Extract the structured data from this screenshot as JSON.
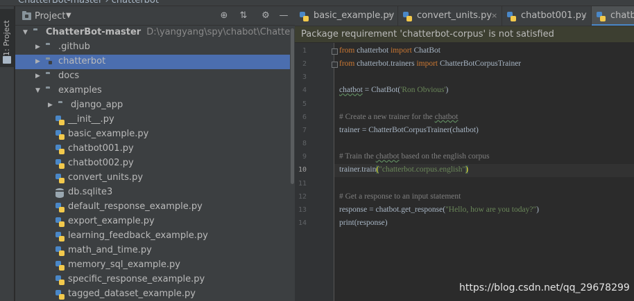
{
  "window": {
    "title_fragment": "ChatterBot-master  ›  chatterbot"
  },
  "tool_window": {
    "project_label": "1: Project"
  },
  "project_panel": {
    "title": "Project",
    "dropdown_icon": "caret-down-icon",
    "header_icons": [
      "crosshair-icon",
      "collapse-icon",
      "gear-icon",
      "minimize-icon"
    ],
    "tree": [
      {
        "label": "ChatterBot-master",
        "path": "D:\\yangyang\\spy\\chabot\\ChatterBot-master",
        "type": "folder",
        "depth": 0,
        "arrow": "down",
        "bold": true
      },
      {
        "label": ".github",
        "type": "folder",
        "depth": 1,
        "arrow": "right"
      },
      {
        "label": "chatterbot",
        "type": "folder",
        "depth": 1,
        "arrow": "right",
        "selected": true
      },
      {
        "label": "docs",
        "type": "folder",
        "depth": 1,
        "arrow": "right"
      },
      {
        "label": "examples",
        "type": "folder",
        "depth": 1,
        "arrow": "down"
      },
      {
        "label": "django_app",
        "type": "folder",
        "depth": 2,
        "arrow": "right"
      },
      {
        "label": "__init__.py",
        "type": "py",
        "depth": 2
      },
      {
        "label": "basic_example.py",
        "type": "py",
        "depth": 2
      },
      {
        "label": "chatbot001.py",
        "type": "py",
        "depth": 2
      },
      {
        "label": "chatbot002.py",
        "type": "py",
        "depth": 2
      },
      {
        "label": "convert_units.py",
        "type": "py",
        "depth": 2
      },
      {
        "label": "db.sqlite3",
        "type": "db",
        "depth": 2
      },
      {
        "label": "default_response_example.py",
        "type": "py",
        "depth": 2
      },
      {
        "label": "export_example.py",
        "type": "py",
        "depth": 2
      },
      {
        "label": "learning_feedback_example.py",
        "type": "py",
        "depth": 2
      },
      {
        "label": "math_and_time.py",
        "type": "py",
        "depth": 2
      },
      {
        "label": "memory_sql_example.py",
        "type": "py",
        "depth": 2
      },
      {
        "label": "specific_response_example.py",
        "type": "py",
        "depth": 2
      },
      {
        "label": "tagged_dataset_example.py",
        "type": "py",
        "depth": 2
      }
    ]
  },
  "editor": {
    "tabs": [
      {
        "label": "basic_example.py",
        "close": "×"
      },
      {
        "label": "convert_units.py",
        "close": "×"
      },
      {
        "label": "chatbot001.py",
        "close": "×"
      },
      {
        "label": "chatbo",
        "active": true
      }
    ],
    "banner": "Package requirement 'chatterbot-corpus' is not satisfied",
    "current_line": 10,
    "lines": [
      [
        {
          "t": "from",
          "c": "kw"
        },
        {
          "t": " chatterbot "
        },
        {
          "t": "import",
          "c": "kw"
        },
        {
          "t": " ChatBot"
        }
      ],
      [
        {
          "t": "from",
          "c": "kw"
        },
        {
          "t": " chatterbot.trainers "
        },
        {
          "t": "import",
          "c": "kw"
        },
        {
          "t": " ChatterBotCorpusTrainer"
        }
      ],
      [],
      [
        {
          "t": "chatbot",
          "c": "wavy"
        },
        {
          "t": " = ChatBot("
        },
        {
          "t": "'Ron Obvious'",
          "c": "str"
        },
        {
          "t": ")"
        }
      ],
      [],
      [
        {
          "t": "# Create a new trainer for the ",
          "c": "cm"
        },
        {
          "t": "chatbot",
          "c": "cm wavy"
        }
      ],
      [
        {
          "t": "trainer = ChatterBotCorpusTrainer(chatbot)"
        }
      ],
      [],
      [
        {
          "t": "# Train the ",
          "c": "cm"
        },
        {
          "t": "chatbot",
          "c": "cm wavy"
        },
        {
          "t": " based on the english corpus",
          "c": "cm"
        }
      ],
      [
        {
          "t": "trainer.train"
        },
        {
          "t": "(",
          "c": "brace"
        },
        {
          "t": "\"chatterbot.corpus.english\"",
          "c": "str"
        },
        {
          "t": ")",
          "c": "brace"
        }
      ],
      [],
      [
        {
          "t": "# Get a response to an input statement",
          "c": "cm"
        }
      ],
      [
        {
          "t": "response = chatbot.get_response("
        },
        {
          "t": "\"Hello, how are you today?\"",
          "c": "str"
        },
        {
          "t": ")"
        }
      ],
      [
        {
          "t": "print(response)"
        }
      ]
    ]
  },
  "watermark": "https://blog.csdn.net/qq_29678299"
}
